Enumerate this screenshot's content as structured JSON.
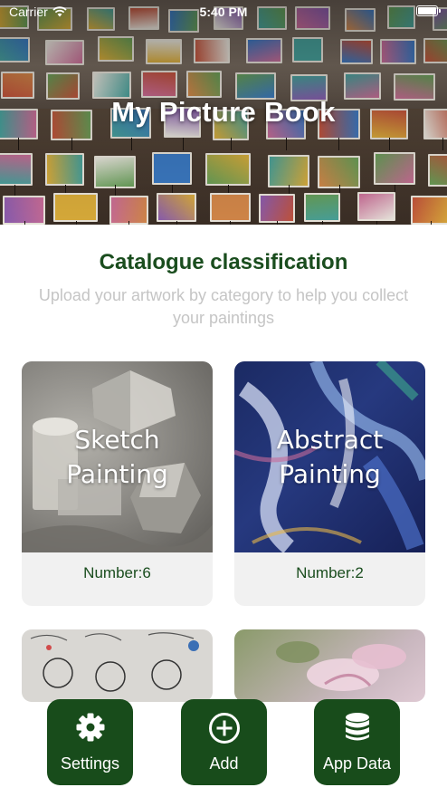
{
  "status_bar": {
    "carrier": "Carrier",
    "time": "5:40 PM"
  },
  "header": {
    "title": "My Picture Book"
  },
  "section": {
    "title": "Catalogue classification",
    "subtitle": "Upload your artwork by category to help you collect your paintings"
  },
  "categories": [
    {
      "label_line1": "Sketch",
      "label_line2": "Painting",
      "count": "Number:6"
    },
    {
      "label_line1": "Abstract",
      "label_line2": "Painting",
      "count": "Number:2"
    },
    {
      "label_line1": "",
      "label_line2": "",
      "count": ""
    },
    {
      "label_line1": "",
      "label_line2": "",
      "count": ""
    }
  ],
  "toolbar": {
    "settings_label": "Settings",
    "add_label": "Add",
    "app_data_label": "App Data"
  },
  "colors": {
    "accent_green": "#184c1b",
    "title_green": "#1a4d1e",
    "subtitle_gray": "#c5c5c5",
    "card_bg": "#f1f1f1"
  },
  "icons": {
    "settings": "gear-icon",
    "add": "plus-circle-icon",
    "app_data": "database-icon",
    "wifi": "wifi-icon",
    "battery": "battery-icon"
  }
}
